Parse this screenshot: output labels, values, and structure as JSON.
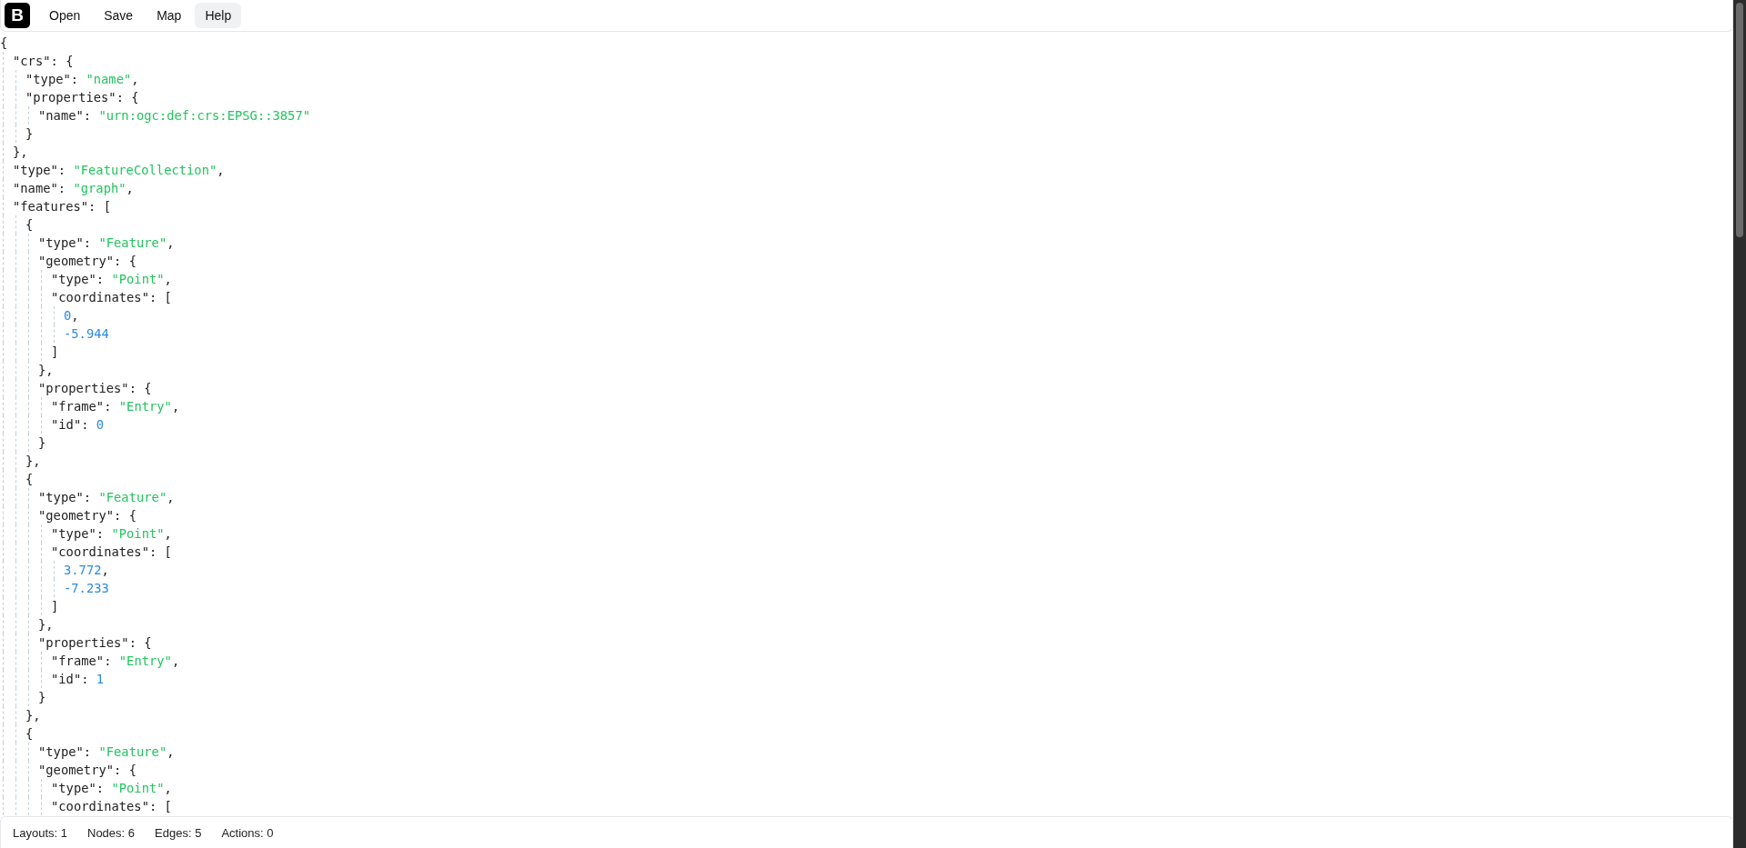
{
  "logo": "B",
  "menu": [
    {
      "label": "Open",
      "selected": false
    },
    {
      "label": "Save",
      "selected": false
    },
    {
      "label": "Map",
      "selected": false
    },
    {
      "label": "Help",
      "selected": true
    }
  ],
  "editor": {
    "lines": [
      {
        "tokens": [
          {
            "kind": "plain",
            "text": "{"
          }
        ],
        "children": [
          {
            "tokens": [
              {
                "kind": "plain",
                "text": "\"crs\": {"
              }
            ],
            "children": [
              {
                "tokens": [
                  {
                    "kind": "plain",
                    "text": "\"type\": "
                  },
                  {
                    "kind": "string",
                    "text": "\"name\""
                  },
                  {
                    "kind": "plain",
                    "text": ","
                  }
                ]
              },
              {
                "tokens": [
                  {
                    "kind": "plain",
                    "text": "\"properties\": {"
                  }
                ],
                "children": [
                  {
                    "tokens": [
                      {
                        "kind": "plain",
                        "text": "\"name\": "
                      },
                      {
                        "kind": "string",
                        "text": "\"urn:ogc:def:crs:EPSG::3857\""
                      }
                    ]
                  }
                ]
              },
              {
                "tokens": [
                  {
                    "kind": "plain",
                    "text": "}"
                  }
                ]
              }
            ]
          },
          {
            "tokens": [
              {
                "kind": "plain",
                "text": "},"
              }
            ]
          },
          {
            "tokens": [
              {
                "kind": "plain",
                "text": "\"type\": "
              },
              {
                "kind": "string",
                "text": "\"FeatureCollection\""
              },
              {
                "kind": "plain",
                "text": ","
              }
            ]
          },
          {
            "tokens": [
              {
                "kind": "plain",
                "text": "\"name\": "
              },
              {
                "kind": "string",
                "text": "\"graph\""
              },
              {
                "kind": "plain",
                "text": ","
              }
            ]
          },
          {
            "tokens": [
              {
                "kind": "plain",
                "text": "\"features\": ["
              }
            ],
            "children": [
              {
                "tokens": [
                  {
                    "kind": "plain",
                    "text": "{"
                  }
                ],
                "children": [
                  {
                    "tokens": [
                      {
                        "kind": "plain",
                        "text": "\"type\": "
                      },
                      {
                        "kind": "string",
                        "text": "\"Feature\""
                      },
                      {
                        "kind": "plain",
                        "text": ","
                      }
                    ]
                  },
                  {
                    "tokens": [
                      {
                        "kind": "plain",
                        "text": "\"geometry\": {"
                      }
                    ],
                    "children": [
                      {
                        "tokens": [
                          {
                            "kind": "plain",
                            "text": "\"type\": "
                          },
                          {
                            "kind": "string",
                            "text": "\"Point\""
                          },
                          {
                            "kind": "plain",
                            "text": ","
                          }
                        ]
                      },
                      {
                        "tokens": [
                          {
                            "kind": "plain",
                            "text": "\"coordinates\": ["
                          }
                        ],
                        "children": [
                          {
                            "tokens": [
                              {
                                "kind": "number",
                                "text": "0"
                              },
                              {
                                "kind": "plain",
                                "text": ","
                              }
                            ]
                          },
                          {
                            "tokens": [
                              {
                                "kind": "number",
                                "text": "-5.944"
                              }
                            ]
                          }
                        ]
                      },
                      {
                        "tokens": [
                          {
                            "kind": "plain",
                            "text": "]"
                          }
                        ]
                      }
                    ]
                  },
                  {
                    "tokens": [
                      {
                        "kind": "plain",
                        "text": "},"
                      }
                    ]
                  },
                  {
                    "tokens": [
                      {
                        "kind": "plain",
                        "text": "\"properties\": {"
                      }
                    ],
                    "children": [
                      {
                        "tokens": [
                          {
                            "kind": "plain",
                            "text": "\"frame\": "
                          },
                          {
                            "kind": "string",
                            "text": "\"Entry\""
                          },
                          {
                            "kind": "plain",
                            "text": ","
                          }
                        ]
                      },
                      {
                        "tokens": [
                          {
                            "kind": "plain",
                            "text": "\"id\": "
                          },
                          {
                            "kind": "number",
                            "text": "0"
                          }
                        ]
                      }
                    ]
                  },
                  {
                    "tokens": [
                      {
                        "kind": "plain",
                        "text": "}"
                      }
                    ]
                  }
                ]
              },
              {
                "tokens": [
                  {
                    "kind": "plain",
                    "text": "},"
                  }
                ]
              },
              {
                "tokens": [
                  {
                    "kind": "plain",
                    "text": "{"
                  }
                ],
                "children": [
                  {
                    "tokens": [
                      {
                        "kind": "plain",
                        "text": "\"type\": "
                      },
                      {
                        "kind": "string",
                        "text": "\"Feature\""
                      },
                      {
                        "kind": "plain",
                        "text": ","
                      }
                    ]
                  },
                  {
                    "tokens": [
                      {
                        "kind": "plain",
                        "text": "\"geometry\": {"
                      }
                    ],
                    "children": [
                      {
                        "tokens": [
                          {
                            "kind": "plain",
                            "text": "\"type\": "
                          },
                          {
                            "kind": "string",
                            "text": "\"Point\""
                          },
                          {
                            "kind": "plain",
                            "text": ","
                          }
                        ]
                      },
                      {
                        "tokens": [
                          {
                            "kind": "plain",
                            "text": "\"coordinates\": ["
                          }
                        ],
                        "children": [
                          {
                            "tokens": [
                              {
                                "kind": "number",
                                "text": "3.772"
                              },
                              {
                                "kind": "plain",
                                "text": ","
                              }
                            ]
                          },
                          {
                            "tokens": [
                              {
                                "kind": "number",
                                "text": "-7.233"
                              }
                            ]
                          }
                        ]
                      },
                      {
                        "tokens": [
                          {
                            "kind": "plain",
                            "text": "]"
                          }
                        ]
                      }
                    ]
                  },
                  {
                    "tokens": [
                      {
                        "kind": "plain",
                        "text": "},"
                      }
                    ]
                  },
                  {
                    "tokens": [
                      {
                        "kind": "plain",
                        "text": "\"properties\": {"
                      }
                    ],
                    "children": [
                      {
                        "tokens": [
                          {
                            "kind": "plain",
                            "text": "\"frame\": "
                          },
                          {
                            "kind": "string",
                            "text": "\"Entry\""
                          },
                          {
                            "kind": "plain",
                            "text": ","
                          }
                        ]
                      },
                      {
                        "tokens": [
                          {
                            "kind": "plain",
                            "text": "\"id\": "
                          },
                          {
                            "kind": "number",
                            "text": "1"
                          }
                        ]
                      }
                    ]
                  },
                  {
                    "tokens": [
                      {
                        "kind": "plain",
                        "text": "}"
                      }
                    ]
                  }
                ]
              },
              {
                "tokens": [
                  {
                    "kind": "plain",
                    "text": "},"
                  }
                ]
              },
              {
                "tokens": [
                  {
                    "kind": "plain",
                    "text": "{"
                  }
                ],
                "children": [
                  {
                    "tokens": [
                      {
                        "kind": "plain",
                        "text": "\"type\": "
                      },
                      {
                        "kind": "string",
                        "text": "\"Feature\""
                      },
                      {
                        "kind": "plain",
                        "text": ","
                      }
                    ]
                  },
                  {
                    "tokens": [
                      {
                        "kind": "plain",
                        "text": "\"geometry\": {"
                      }
                    ],
                    "children": [
                      {
                        "tokens": [
                          {
                            "kind": "plain",
                            "text": "\"type\": "
                          },
                          {
                            "kind": "string",
                            "text": "\"Point\""
                          },
                          {
                            "kind": "plain",
                            "text": ","
                          }
                        ]
                      },
                      {
                        "tokens": [
                          {
                            "kind": "plain",
                            "text": "\"coordinates\": ["
                          }
                        ]
                      }
                    ]
                  }
                ]
              }
            ]
          }
        ]
      }
    ]
  },
  "status_bar": [
    "Layouts: 1",
    "Nodes: 6",
    "Edges: 5",
    "Actions: 0"
  ]
}
